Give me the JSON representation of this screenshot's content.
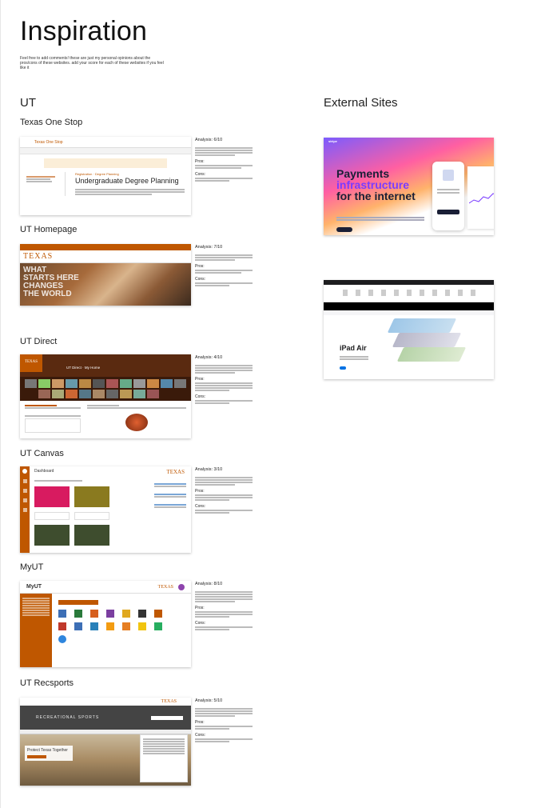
{
  "page": {
    "title": "Inspiration",
    "intro": "Feel free to add comments! these are just my personal opinions about the pros/cons of these websites. add your score for each of these websites if you feel like it"
  },
  "columns": {
    "ut": "UT",
    "external": "External Sites"
  },
  "sites": [
    {
      "label": "Texas One Stop",
      "score": "Analysis: 6/10",
      "shot": {
        "brand": "Texas One Stop",
        "headline": "Undergraduate Degree Planning"
      },
      "sections": [
        "Pros:",
        "Cons:"
      ]
    },
    {
      "label": "UT Homepage",
      "score": "Analysis: 7/10",
      "shot": {
        "brand": "TEXAS",
        "hero": "WHAT STARTS HERE CHANGES THE WORLD"
      },
      "sections": [
        "Pros:",
        "Cons:"
      ]
    },
    {
      "label": "UT Direct",
      "score": "Analysis: 4/10",
      "shot": {
        "brand": "TEXAS",
        "headline": "UT Direct · My Home"
      },
      "sections": [
        "Pros:",
        "Cons:"
      ]
    },
    {
      "label": "UT Canvas",
      "score": "Analysis: 3/10",
      "shot": {
        "headline": "Dashboard",
        "brand": "TEXAS"
      },
      "sections": [
        "Pros:",
        "Cons:"
      ]
    },
    {
      "label": "MyUT",
      "score": "Analysis: 8/10",
      "shot": {
        "brand": "MyUT",
        "logo": "TEXAS"
      },
      "sections": [
        "Pros:",
        "Cons:"
      ]
    },
    {
      "label": "UT Recsports",
      "score": "Analysis: 5/10",
      "shot": {
        "brand": "RECREATIONAL SPORTS",
        "logo": "TEXAS",
        "hero": "Protect Texas Together"
      },
      "sections": [
        "Pros:",
        "Cons:"
      ]
    }
  ],
  "external": [
    {
      "name": "stripe",
      "headline_1": "Payments",
      "headline_2": "infrastructure",
      "headline_3": "for the internet"
    },
    {
      "name": "apple",
      "product": "iPad Air"
    }
  ],
  "colors": {
    "ut_orange": "#bf5700",
    "canvas_pink": "#d81b60",
    "canvas_olive": "#8a7a1f",
    "canvas_green": "#3e4d2e"
  }
}
